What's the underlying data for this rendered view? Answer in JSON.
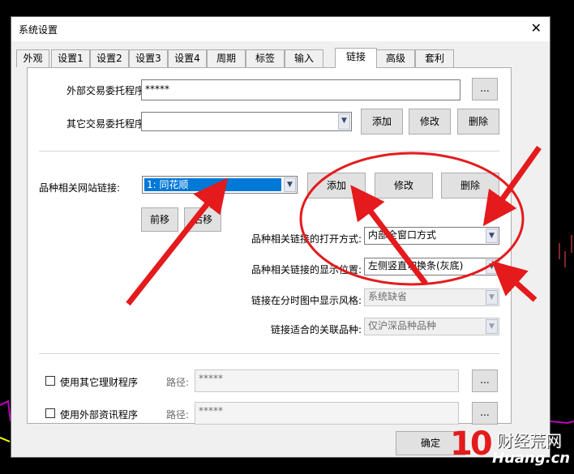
{
  "window": {
    "title": "系统设置",
    "close_glyph": "✕"
  },
  "tabs": [
    {
      "label": "外观"
    },
    {
      "label": "设置1"
    },
    {
      "label": "设置2"
    },
    {
      "label": "设置3"
    },
    {
      "label": "设置4"
    },
    {
      "label": "周期"
    },
    {
      "label": "标签"
    },
    {
      "label": "输入"
    },
    {
      "label": "链接",
      "active": true
    },
    {
      "label": "高级"
    },
    {
      "label": "套利"
    }
  ],
  "trade": {
    "external_label": "外部交易委托程序:",
    "external_value": "*****",
    "browse_label": "...",
    "other_label": "其它交易委托程序:",
    "other_value": "",
    "add_label": "添加",
    "edit_label": "修改",
    "delete_label": "删除"
  },
  "links": {
    "site_label": "品种相关网站链接:",
    "site_selected": "1: 同花顺",
    "add_label": "添加",
    "edit_label": "修改",
    "delete_label": "删除",
    "forward_label": "前移",
    "back_label": "后移",
    "open_label": "品种相关链接的打开方式:",
    "open_value": "内部全窗口方式",
    "pos_label": "品种相关链接的显示位置:",
    "pos_value": "左侧竖直切换条(灰底)",
    "style_label": "链接在分时图中显示风格:",
    "style_value": "系统缺省",
    "assoc_label": "链接适合的关联品种:",
    "assoc_value": "仅沪深品种品种"
  },
  "programs": {
    "finance_label": "使用其它理财程序",
    "finance_path_label": "路径:",
    "finance_path": "*****",
    "info_label": "使用外部资讯程序",
    "info_path_label": "路径:",
    "info_path": "*****",
    "browse_label": "..."
  },
  "footer": {
    "ok_label": "确定"
  },
  "watermark": {
    "logo": "10",
    "text": "财经荒网",
    "url": "Huang.cn"
  },
  "colors": {
    "annotation": "#e41a1c",
    "selection": "#0078d7"
  }
}
